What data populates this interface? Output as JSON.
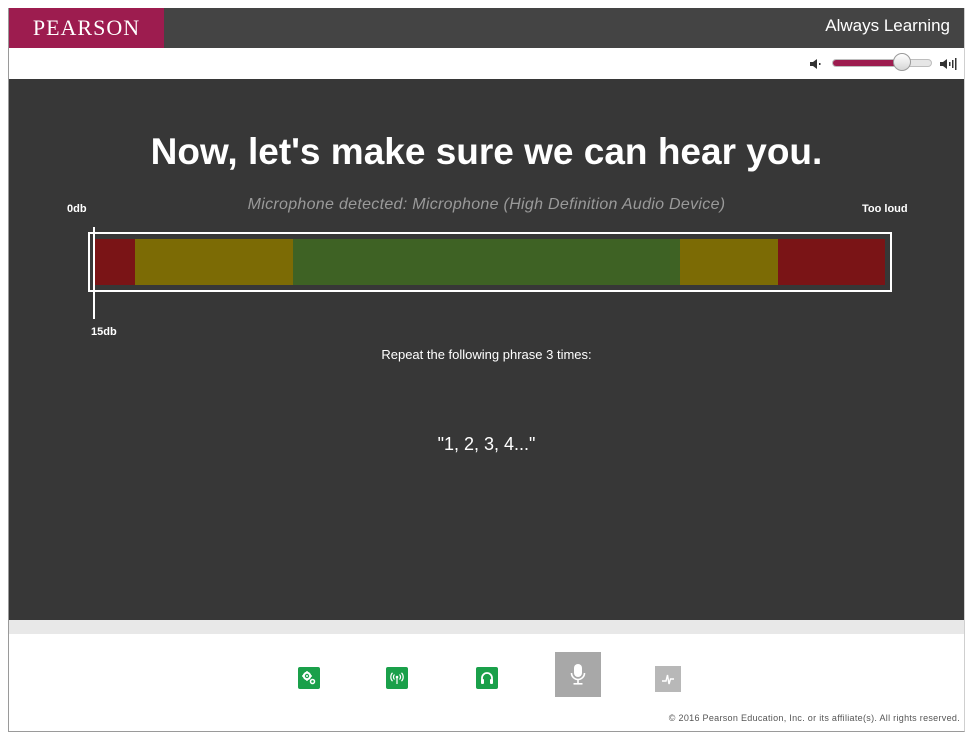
{
  "header": {
    "brand": "PEARSON",
    "tagline": "Always Learning"
  },
  "volume": {
    "level_percent": 70,
    "low_icon": "speaker-low-icon",
    "high_icon": "speaker-high-icon"
  },
  "main": {
    "heading": "Now, let's make sure we can hear you.",
    "mic_detected": "Microphone detected: Microphone (High Definition Audio Device)",
    "meter": {
      "label_min": "0db",
      "label_max": "Too loud",
      "current_label": "15db",
      "segments": [
        {
          "zone": "too-quiet",
          "color": "#7a1416",
          "share": 5
        },
        {
          "zone": "quiet",
          "color": "#7c6b05",
          "share": 20
        },
        {
          "zone": "good",
          "color": "#3e6224",
          "share": 49
        },
        {
          "zone": "loud",
          "color": "#7c6b05",
          "share": 12.5
        },
        {
          "zone": "too-loud",
          "color": "#7a1416",
          "share": 13.5
        }
      ]
    },
    "instruction": "Repeat the following phrase 3 times:",
    "phrase": "\"1, 2, 3, 4...\""
  },
  "footer": {
    "tools": [
      {
        "name": "settings",
        "icon": "gears-icon",
        "state": "done"
      },
      {
        "name": "connection",
        "icon": "signal-icon",
        "state": "done"
      },
      {
        "name": "headphones",
        "icon": "headphones-icon",
        "state": "done"
      },
      {
        "name": "microphone",
        "icon": "microphone-icon",
        "state": "active"
      },
      {
        "name": "audio-check",
        "icon": "waveform-icon",
        "state": "pending"
      }
    ],
    "copyright": "© 2016 Pearson Education, Inc. or its affiliate(s). All rights reserved."
  },
  "colors": {
    "brand": "#9d1c4f",
    "header_bg": "#444444",
    "stage_bg": "#373737",
    "tool_done": "#1aa04a",
    "tool_active": "#a8a8a8"
  }
}
